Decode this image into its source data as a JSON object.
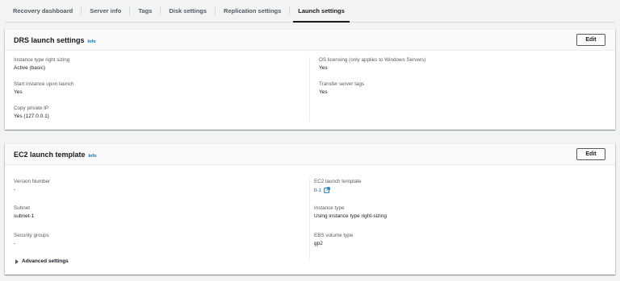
{
  "tabs": [
    {
      "label": "Recovery dashboard"
    },
    {
      "label": "Server info"
    },
    {
      "label": "Tags"
    },
    {
      "label": "Disk settings"
    },
    {
      "label": "Replication settings"
    },
    {
      "label": "Launch settings"
    }
  ],
  "active_tab": "Launch settings",
  "drs_panel": {
    "title": "DRS launch settings",
    "info": "Info",
    "edit": "Edit",
    "left": [
      {
        "label": "Instance type right sizing",
        "value": "Active (basic)"
      },
      {
        "label": "Start instance upon launch",
        "value": "Yes"
      },
      {
        "label": "Copy private IP",
        "value": "Yes (127.0.0.1)"
      }
    ],
    "right": [
      {
        "label": "OS licensing (only applies to Windows Servers)",
        "value": "Yes"
      },
      {
        "label": "Transfer server tags",
        "value": "Yes"
      }
    ]
  },
  "ec2_panel": {
    "title": "EC2 launch template",
    "info": "Info",
    "edit": "Edit",
    "left": [
      {
        "label": "Version Number",
        "value": "-"
      },
      {
        "label": "Subnet",
        "value": "subnet-1"
      },
      {
        "label": "Security groups",
        "value": "-"
      }
    ],
    "right": [
      {
        "label": "EC2 launch template",
        "value": "lt-1"
      },
      {
        "label": "Instance type",
        "value": "Using instance type right-sizing"
      },
      {
        "label": "EBS volume type",
        "value": "gp2"
      }
    ],
    "advanced": "Advanced settings"
  },
  "colors": {
    "link": "#0073bb",
    "background": "#f2f3f3",
    "text": "#16191f"
  }
}
